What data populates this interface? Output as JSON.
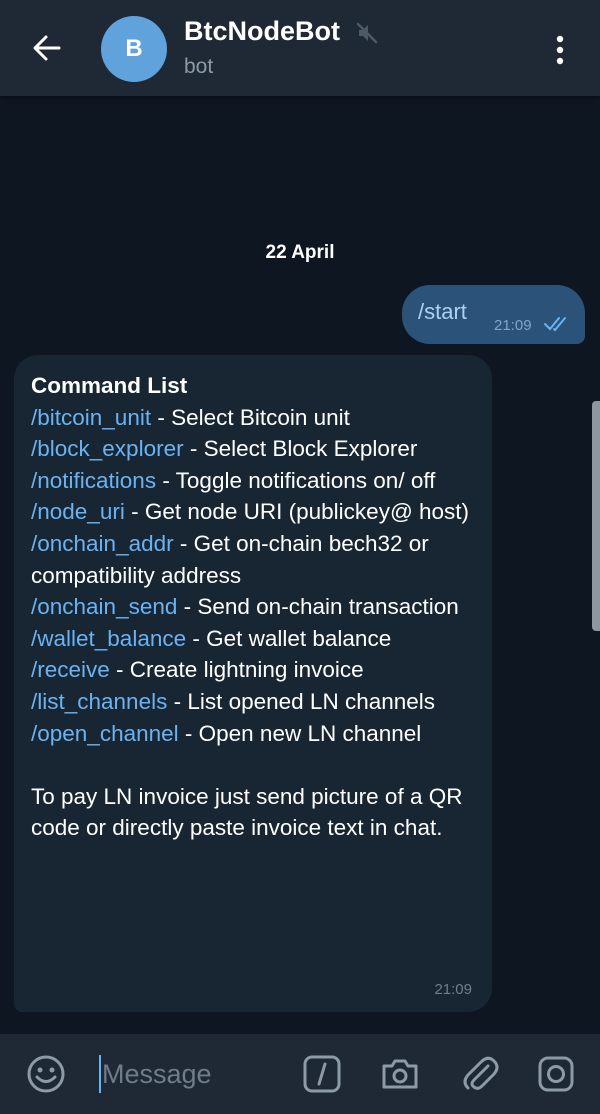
{
  "header": {
    "title": "BtcNodeBot",
    "subtitle": "bot",
    "avatar_letter": "B",
    "avatar_color": "#5fa2dc"
  },
  "chat": {
    "date_separator": "22 April",
    "outgoing": {
      "text": "/start",
      "time": "21:09"
    },
    "incoming": {
      "heading": "Command List",
      "commands": [
        {
          "cmd": "/bitcoin_unit",
          "desc": " - Select Bitcoin unit"
        },
        {
          "cmd": "/block_explorer",
          "desc": " - Select Block Explorer"
        },
        {
          "cmd": "/notifications",
          "desc": " - Toggle notifications on/ off"
        },
        {
          "cmd": "/node_uri",
          "desc": " - Get node URI (publickey@ host)"
        },
        {
          "cmd": "/onchain_addr",
          "desc": " - Get on-chain bech32 or compatibility address"
        },
        {
          "cmd": "/onchain_send",
          "desc": " - Send on-chain transaction"
        },
        {
          "cmd": "/wallet_balance",
          "desc": " - Get wallet balance"
        },
        {
          "cmd": "/receive",
          "desc": " - Create lightning invoice"
        },
        {
          "cmd": "/list_channels",
          "desc": " - List opened LN channels"
        },
        {
          "cmd": "/open_channel",
          "desc": " - Open new LN channel"
        }
      ],
      "footer": "To pay LN invoice just send picture of a QR code or directly paste invoice text in chat.",
      "time": "21:09"
    }
  },
  "composer": {
    "placeholder": "Message"
  },
  "colors": {
    "background": "#0e1621",
    "header": "#1f2936",
    "outgoing_bubble": "#2b5278",
    "incoming_bubble": "#182533",
    "link": "#6ab3f3"
  }
}
